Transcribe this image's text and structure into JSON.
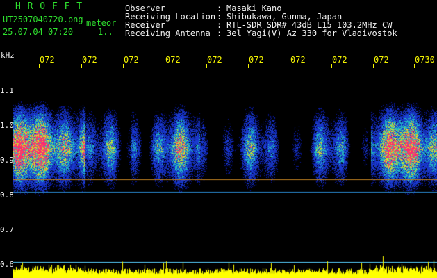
{
  "header": {
    "logo": "H R O F F T",
    "filename": "UT2507040720.png",
    "type": "meteor",
    "timestamp": "25.07.04 07:20",
    "count": "1..",
    "fields": [
      {
        "label": "Observer",
        "value": "Masaki Kano"
      },
      {
        "label": "Receiving Location",
        "value": "Shibukawa, Gunma, Japan"
      },
      {
        "label": "Receiver",
        "value": "RTL-SDR SDR# 43dB L15 103.2MHz CW"
      },
      {
        "label": "Receiving Antenna",
        "value": "3el Yagi(V) Az 330 for Vladivostok"
      }
    ]
  },
  "axes": {
    "unit": "kHz",
    "y_labels": [
      "1.1",
      "1.0",
      "0.9",
      "0.8",
      "0.7",
      "0.6"
    ],
    "x_labels": [
      "072",
      "072",
      "072",
      "072",
      "072",
      "072",
      "072",
      "072",
      "072",
      "0730"
    ]
  },
  "colors": {
    "background": "#000000",
    "header_green": "#2ee02e",
    "header_white": "#f0f0f0",
    "axis_yellow": "#f2f200",
    "signal_low": "#1a3ad0",
    "signal_mid": "#22c0c0",
    "signal_high": "#ff2a70",
    "power_trace": "#ffff00",
    "baseline_line": "#59d0ff"
  }
}
